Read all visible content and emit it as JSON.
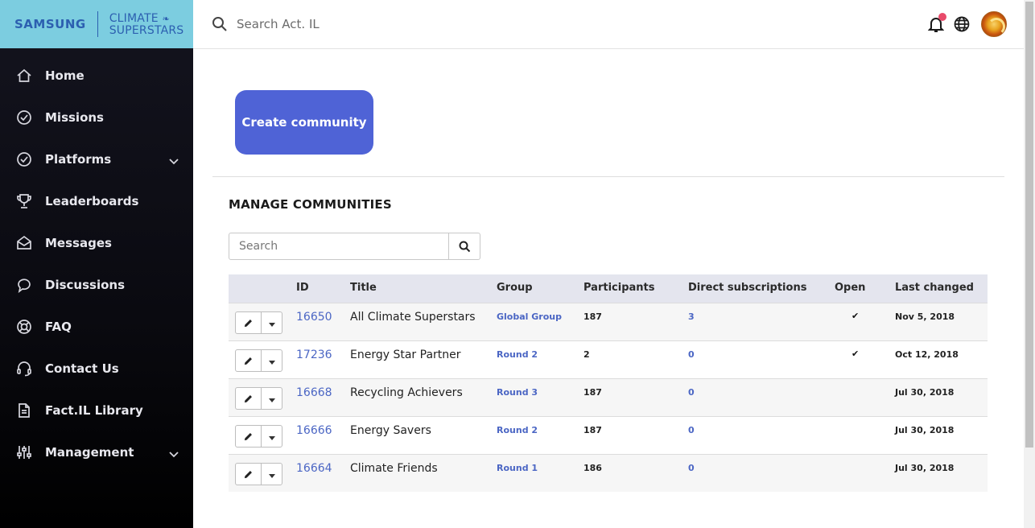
{
  "brand": {
    "samsung": "SAMSUNG",
    "line1": "CLIMATE",
    "line2": "SUPERSTARS",
    "leaf": "⸙"
  },
  "topbar": {
    "search_placeholder": "Search Act. IL"
  },
  "sidebar": {
    "items": [
      {
        "label": "Home",
        "icon": "home-icon"
      },
      {
        "label": "Missions",
        "icon": "check-circle-icon"
      },
      {
        "label": "Platforms",
        "icon": "check-circle-icon",
        "expandable": true
      },
      {
        "label": "Leaderboards",
        "icon": "trophy-icon"
      },
      {
        "label": "Messages",
        "icon": "envelope-icon"
      },
      {
        "label": "Discussions",
        "icon": "chat-icon"
      },
      {
        "label": "FAQ",
        "icon": "lifebuoy-icon"
      },
      {
        "label": "Contact Us",
        "icon": "headset-icon"
      },
      {
        "label": "Fact.IL Library",
        "icon": "document-icon"
      },
      {
        "label": "Management",
        "icon": "sliders-icon",
        "expandable": true
      }
    ]
  },
  "main": {
    "create_button": "Create community",
    "section_title": "MANAGE COMMUNITIES",
    "search_placeholder": "Search",
    "table": {
      "headers": {
        "id": "ID",
        "title": "Title",
        "group": "Group",
        "participants": "Participants",
        "subscriptions": "Direct subscriptions",
        "open": "Open",
        "changed": "Last changed"
      },
      "rows": [
        {
          "id": "16650",
          "title": "All Climate Superstars",
          "group": "Global Group",
          "participants": "187",
          "subscriptions": "3",
          "open": "✔",
          "changed": "Nov 5, 2018"
        },
        {
          "id": "17236",
          "title": "Energy Star Partner",
          "group": "Round 2",
          "participants": "2",
          "subscriptions": "0",
          "open": "✔",
          "changed": "Oct 12, 2018"
        },
        {
          "id": "16668",
          "title": "Recycling Achievers",
          "group": "Round 3",
          "participants": "187",
          "subscriptions": "0",
          "open": "",
          "changed": "Jul 30, 2018"
        },
        {
          "id": "16666",
          "title": "Energy Savers",
          "group": "Round 2",
          "participants": "187",
          "subscriptions": "0",
          "open": "",
          "changed": "Jul 30, 2018"
        },
        {
          "id": "16664",
          "title": "Climate Friends",
          "group": "Round 1",
          "participants": "186",
          "subscriptions": "0",
          "open": "",
          "changed": "Jul 30, 2018"
        }
      ]
    }
  },
  "colors": {
    "sidebar_bg": "#0d0d14",
    "brand_bg": "#7ccde0",
    "accent": "#4f63d6",
    "link": "#4b66c4",
    "notification": "#e84a6a"
  }
}
